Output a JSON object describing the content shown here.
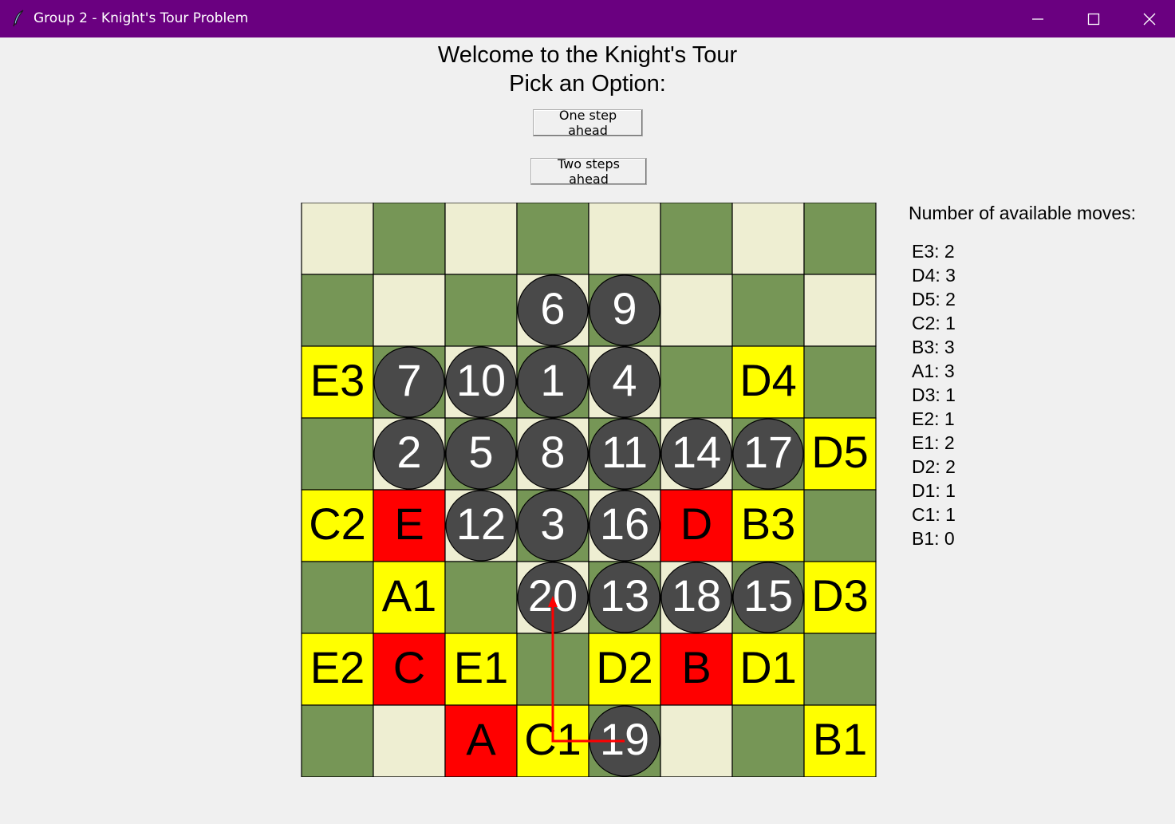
{
  "window": {
    "title": "Group 2 - Knight's Tour Problem",
    "icon": "feather-icon",
    "controls": [
      "minimize-icon",
      "maximize-icon",
      "close-icon"
    ]
  },
  "header": {
    "line1": "Welcome to the Knight's Tour",
    "line2": "Pick an Option:"
  },
  "buttons": {
    "one_step": "One step ahead",
    "two_steps": "Two steps ahead"
  },
  "colors": {
    "light": "#eeeed2",
    "dark": "#769656",
    "yellow": "#ffff00",
    "red": "#ff0000",
    "circle": "#494949",
    "arrow": "#ff0000",
    "titlebar": "#6a0080"
  },
  "board": {
    "size": 8,
    "visited": [
      {
        "n": "1",
        "col": 3,
        "row": 2
      },
      {
        "n": "2",
        "col": 1,
        "row": 3
      },
      {
        "n": "3",
        "col": 3,
        "row": 4
      },
      {
        "n": "4",
        "col": 4,
        "row": 2
      },
      {
        "n": "5",
        "col": 2,
        "row": 3
      },
      {
        "n": "6",
        "col": 3,
        "row": 1
      },
      {
        "n": "7",
        "col": 1,
        "row": 2
      },
      {
        "n": "8",
        "col": 3,
        "row": 3
      },
      {
        "n": "9",
        "col": 4,
        "row": 1
      },
      {
        "n": "10",
        "col": 2,
        "row": 2
      },
      {
        "n": "11",
        "col": 4,
        "row": 3
      },
      {
        "n": "12",
        "col": 2,
        "row": 4
      },
      {
        "n": "13",
        "col": 4,
        "row": 5
      },
      {
        "n": "14",
        "col": 5,
        "row": 3
      },
      {
        "n": "15",
        "col": 6,
        "row": 5
      },
      {
        "n": "16",
        "col": 4,
        "row": 4
      },
      {
        "n": "17",
        "col": 6,
        "row": 3
      },
      {
        "n": "18",
        "col": 5,
        "row": 5
      },
      {
        "n": "19",
        "col": 4,
        "row": 7
      },
      {
        "n": "20",
        "col": 3,
        "row": 5
      }
    ],
    "candidates": [
      {
        "label": "A",
        "col": 2,
        "row": 7
      },
      {
        "label": "B",
        "col": 5,
        "row": 6
      },
      {
        "label": "C",
        "col": 1,
        "row": 6
      },
      {
        "label": "D",
        "col": 5,
        "row": 4
      },
      {
        "label": "E",
        "col": 1,
        "row": 4
      }
    ],
    "lookahead": [
      {
        "label": "E3",
        "col": 0,
        "row": 2
      },
      {
        "label": "D4",
        "col": 6,
        "row": 2
      },
      {
        "label": "D5",
        "col": 7,
        "row": 3
      },
      {
        "label": "C2",
        "col": 0,
        "row": 4
      },
      {
        "label": "B3",
        "col": 6,
        "row": 4
      },
      {
        "label": "A1",
        "col": 1,
        "row": 5
      },
      {
        "label": "D3",
        "col": 7,
        "row": 5
      },
      {
        "label": "E2",
        "col": 0,
        "row": 6
      },
      {
        "label": "E1",
        "col": 2,
        "row": 6
      },
      {
        "label": "D2",
        "col": 4,
        "row": 6
      },
      {
        "label": "D1",
        "col": 6,
        "row": 6
      },
      {
        "label": "C1",
        "col": 3,
        "row": 7
      },
      {
        "label": "B1",
        "col": 7,
        "row": 7
      }
    ],
    "last_move": {
      "from": "19",
      "to": "20"
    }
  },
  "sidebar": {
    "title": "Number of available moves:",
    "moves": [
      "E3: 2",
      "D4: 3",
      "D5: 2",
      "C2: 1",
      "B3: 3",
      "A1: 3",
      "D3: 1",
      "E2: 1",
      "E1: 2",
      "D2: 2",
      "D1: 1",
      "C1: 1",
      "B1: 0"
    ]
  }
}
